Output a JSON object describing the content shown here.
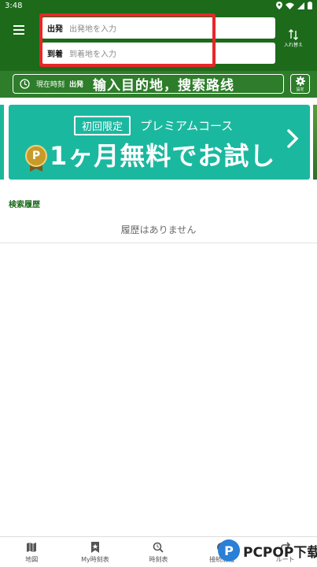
{
  "status_bar": {
    "time": "3:48"
  },
  "header": {
    "from_label": "出発",
    "from_placeholder": "出発地を入力",
    "to_label": "到着",
    "to_placeholder": "到着地を入力",
    "swap_label": "入れ替え"
  },
  "time_bar": {
    "label": "現在時刻",
    "mode": "出発",
    "overlay_text": "输入目的地，搜索路线",
    "settings_label": "設定"
  },
  "banner": {
    "tag": "初回限定",
    "subtitle": "プレミアムコース",
    "badge": "P",
    "main_text": "1ヶ月無料でお試し"
  },
  "history": {
    "title": "検索履歴",
    "empty_message": "履歴はありません"
  },
  "bottom_nav": {
    "items": [
      {
        "label": "地図",
        "icon": "map-icon"
      },
      {
        "label": "My時刻表",
        "icon": "bookmark-star-icon"
      },
      {
        "label": "時刻表",
        "icon": "search-timetable-icon"
      },
      {
        "label": "接続情報",
        "icon": "info-icon"
      },
      {
        "label": "ルート",
        "icon": "route-icon"
      }
    ]
  },
  "watermark": {
    "text": "PCPOP下载"
  },
  "colors": {
    "header_green": "#1c6a1a",
    "bar_green": "#2d7d2a",
    "banner_teal": "#1bb8a0",
    "highlight_red": "#e8262a"
  }
}
